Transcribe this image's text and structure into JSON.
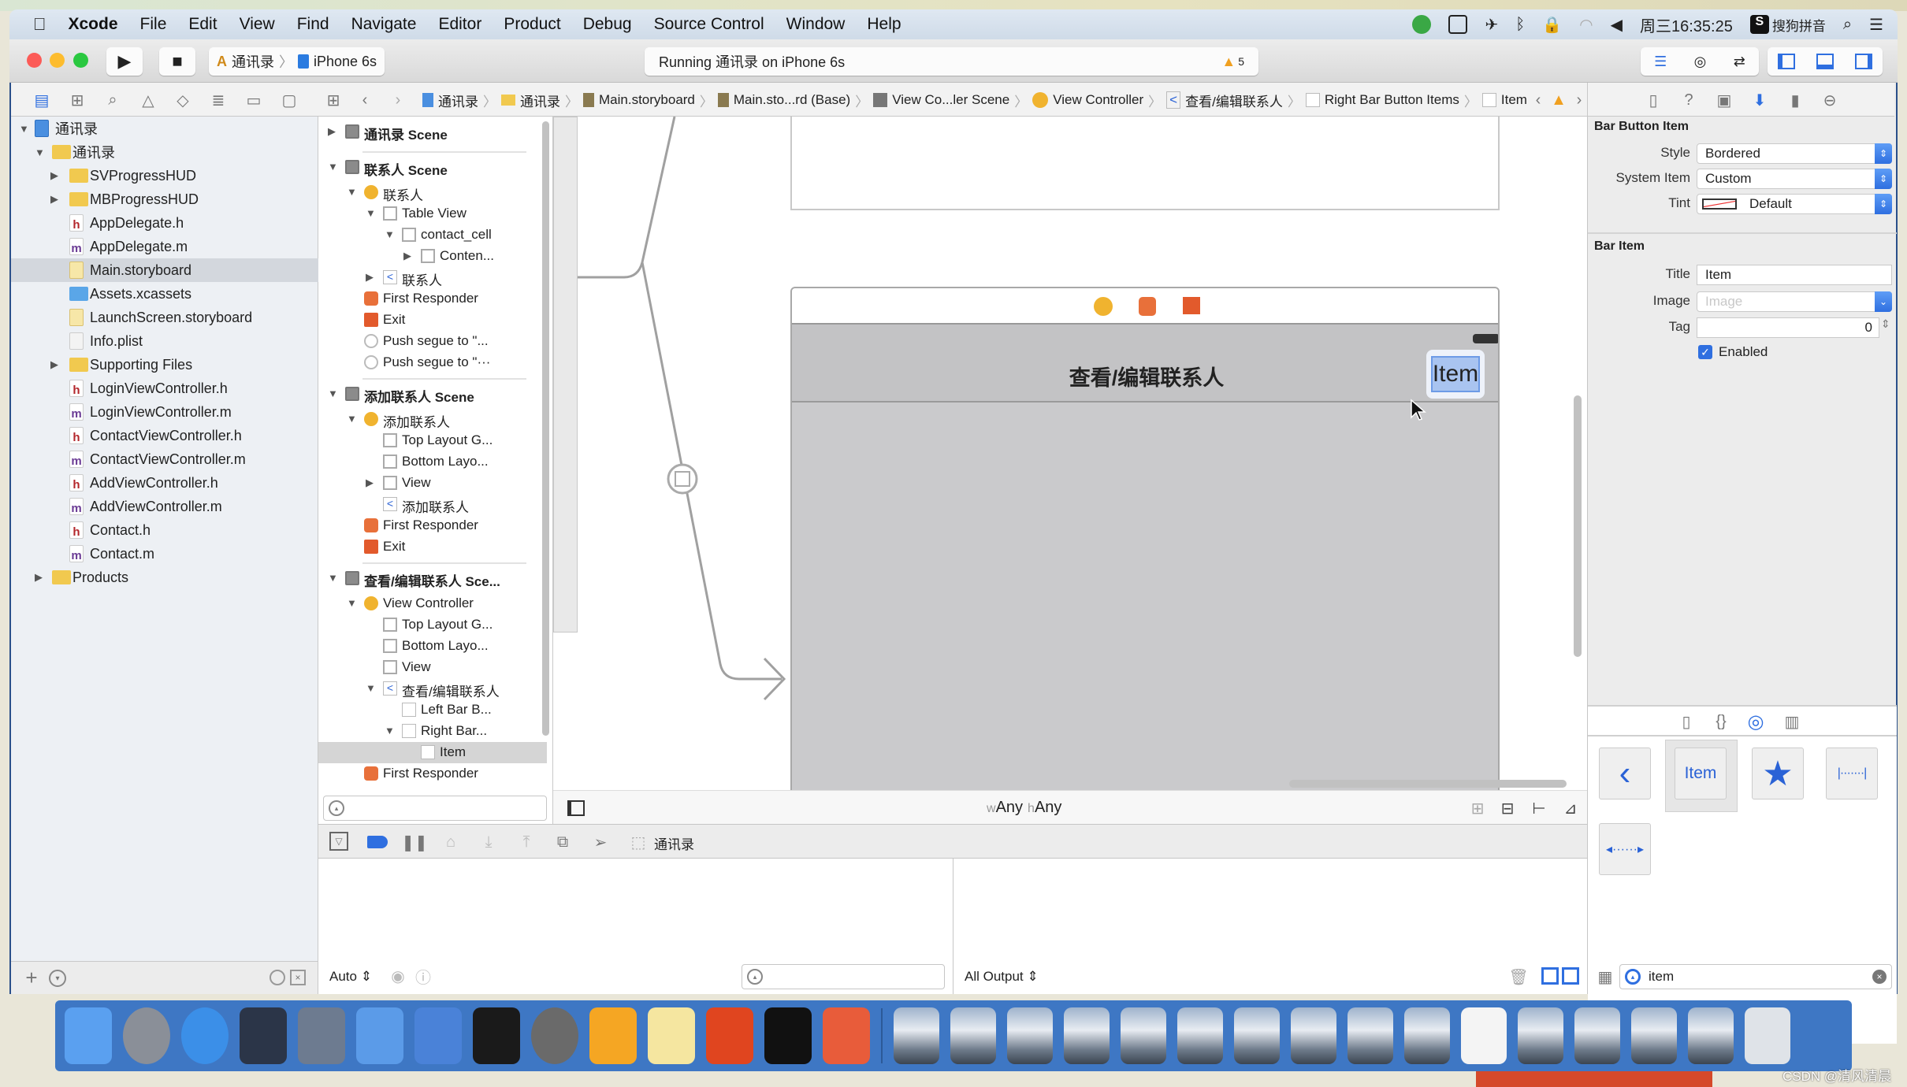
{
  "menubar": {
    "apple": "",
    "app": "Xcode",
    "items": [
      "File",
      "Edit",
      "View",
      "Find",
      "Navigate",
      "Editor",
      "Product",
      "Debug",
      "Source Control",
      "Window",
      "Help"
    ],
    "clock": "周三16:35:25",
    "ime": "搜狗拼音"
  },
  "toolbar": {
    "scheme": "通讯录",
    "device": "iPhone 6s",
    "activity": "Running 通讯录 on iPhone 6s",
    "warnings": "5"
  },
  "jumpbar": {
    "items": [
      "通讯录",
      "通讯录",
      "Main.storyboard",
      "Main.sto...rd (Base)",
      "View Co...ler Scene",
      "View Controller",
      "查看/编辑联系人",
      "Right Bar Button Items",
      "Item"
    ]
  },
  "navigator": {
    "items": [
      {
        "label": "通讯录",
        "depth": 0,
        "kind": "project",
        "disclosure": "open"
      },
      {
        "label": "通讯录",
        "depth": 1,
        "kind": "folder",
        "disclosure": "open"
      },
      {
        "label": "SVProgressHUD",
        "depth": 2,
        "kind": "folder",
        "disclosure": "closed"
      },
      {
        "label": "MBProgressHUD",
        "depth": 2,
        "kind": "folder",
        "disclosure": "closed"
      },
      {
        "label": "AppDelegate.h",
        "depth": 2,
        "kind": "h"
      },
      {
        "label": "AppDelegate.m",
        "depth": 2,
        "kind": "m"
      },
      {
        "label": "Main.storyboard",
        "depth": 2,
        "kind": "storyboard",
        "selected": true
      },
      {
        "label": "Assets.xcassets",
        "depth": 2,
        "kind": "xcassets"
      },
      {
        "label": "LaunchScreen.storyboard",
        "depth": 2,
        "kind": "storyboard"
      },
      {
        "label": "Info.plist",
        "depth": 2,
        "kind": "plist"
      },
      {
        "label": "Supporting Files",
        "depth": 2,
        "kind": "folder",
        "disclosure": "closed"
      },
      {
        "label": "LoginViewController.h",
        "depth": 2,
        "kind": "h"
      },
      {
        "label": "LoginViewController.m",
        "depth": 2,
        "kind": "m"
      },
      {
        "label": "ContactViewController.h",
        "depth": 2,
        "kind": "h"
      },
      {
        "label": "ContactViewController.m",
        "depth": 2,
        "kind": "m"
      },
      {
        "label": "AddViewController.h",
        "depth": 2,
        "kind": "h"
      },
      {
        "label": "AddViewController.m",
        "depth": 2,
        "kind": "m"
      },
      {
        "label": "Contact.h",
        "depth": 2,
        "kind": "h"
      },
      {
        "label": "Contact.m",
        "depth": 2,
        "kind": "m"
      },
      {
        "label": "Products",
        "depth": 1,
        "kind": "folder",
        "disclosure": "closed"
      }
    ]
  },
  "outline": {
    "items": [
      {
        "label": "通讯录 Scene",
        "depth": 0,
        "kind": "scene",
        "disclosure": "closed",
        "header": true
      },
      {
        "label": "联系人 Scene",
        "depth": 0,
        "kind": "scene",
        "disclosure": "open",
        "header": true
      },
      {
        "label": "联系人",
        "depth": 1,
        "kind": "vc",
        "disclosure": "open"
      },
      {
        "label": "Table View",
        "depth": 2,
        "kind": "view",
        "disclosure": "open"
      },
      {
        "label": "contact_cell",
        "depth": 3,
        "kind": "view",
        "disclosure": "open"
      },
      {
        "label": "Conten...",
        "depth": 4,
        "kind": "view",
        "disclosure": "closed"
      },
      {
        "label": "联系人",
        "depth": 2,
        "kind": "navitem",
        "disclosure": "closed"
      },
      {
        "label": "First Responder",
        "depth": 1,
        "kind": "responder"
      },
      {
        "label": "Exit",
        "depth": 1,
        "kind": "exit"
      },
      {
        "label": "Push segue to \"...",
        "depth": 1,
        "kind": "segue"
      },
      {
        "label": "Push segue to \"···",
        "depth": 1,
        "kind": "segue"
      },
      {
        "label": "添加联系人 Scene",
        "depth": 0,
        "kind": "scene",
        "disclosure": "open",
        "header": true
      },
      {
        "label": "添加联系人",
        "depth": 1,
        "kind": "vc",
        "disclosure": "open"
      },
      {
        "label": "Top Layout G...",
        "depth": 2,
        "kind": "layout"
      },
      {
        "label": "Bottom Layo...",
        "depth": 2,
        "kind": "layout"
      },
      {
        "label": "View",
        "depth": 2,
        "kind": "view",
        "disclosure": "closed"
      },
      {
        "label": "添加联系人",
        "depth": 2,
        "kind": "navitem"
      },
      {
        "label": "First Responder",
        "depth": 1,
        "kind": "responder"
      },
      {
        "label": "Exit",
        "depth": 1,
        "kind": "exit"
      },
      {
        "label": "查看/编辑联系人 Sce...",
        "depth": 0,
        "kind": "scene",
        "disclosure": "open",
        "header": true
      },
      {
        "label": "View Controller",
        "depth": 1,
        "kind": "vc",
        "disclosure": "open"
      },
      {
        "label": "Top Layout G...",
        "depth": 2,
        "kind": "layout"
      },
      {
        "label": "Bottom Layo...",
        "depth": 2,
        "kind": "layout"
      },
      {
        "label": "View",
        "depth": 2,
        "kind": "view"
      },
      {
        "label": "查看/编辑联系人",
        "depth": 2,
        "kind": "navitem",
        "disclosure": "open"
      },
      {
        "label": "Left Bar B...",
        "depth": 3,
        "kind": "baritem"
      },
      {
        "label": "Right Bar...",
        "depth": 3,
        "kind": "baritem",
        "disclosure": "open"
      },
      {
        "label": "Item",
        "depth": 4,
        "kind": "baritem",
        "selected": true
      },
      {
        "label": "First Responder",
        "depth": 1,
        "kind": "responder"
      }
    ]
  },
  "canvas": {
    "nav_title": "查看/编辑联系人",
    "bar_item": "Item",
    "size_w_prefix": "w",
    "size_w": "Any",
    "size_h_prefix": "h",
    "size_h": "Any"
  },
  "inspector": {
    "section1": "Bar Button Item",
    "style_label": "Style",
    "style_value": "Bordered",
    "system_item_label": "System Item",
    "system_item_value": "Custom",
    "tint_label": "Tint",
    "tint_value": "Default",
    "section2": "Bar Item",
    "title_label": "Title",
    "title_value": "Item",
    "image_label": "Image",
    "image_placeholder": "Image",
    "tag_label": "Tag",
    "tag_value": "0",
    "enabled_label": "Enabled",
    "enabled": true
  },
  "library": {
    "tiles": [
      "back-chevron",
      "Item",
      "star",
      "fixed-space",
      "flexible-space"
    ],
    "item_tile_label": "Item",
    "search_value": "item"
  },
  "debug": {
    "scheme": "通讯录",
    "auto": "Auto ⇕",
    "output": "All Output ⇕"
  },
  "dock": {
    "icons": [
      "finder",
      "launchpad",
      "safari",
      "mouse",
      "photo-booth",
      "xcode",
      "instruments",
      "terminal",
      "system-preferences",
      "sketch",
      "notes",
      "powerpoint",
      "console",
      "media-player",
      "window-1",
      "window-2",
      "window-3",
      "window-4",
      "window-5",
      "window-6",
      "window-7",
      "window-8",
      "window-9",
      "window-10",
      "document",
      "window-11",
      "window-12",
      "window-13",
      "window-14",
      "trash"
    ]
  },
  "watermark": "CSDN @清风清晨",
  "colors": {
    "accent": "#2f6fe0",
    "dock": "#3e77c4",
    "selection": "#d3d7dd"
  }
}
